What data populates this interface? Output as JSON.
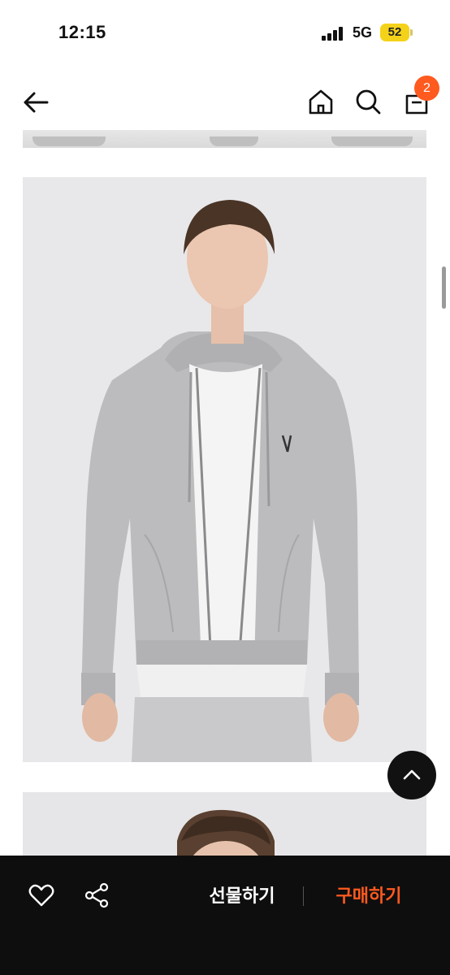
{
  "status_bar": {
    "time": "12:15",
    "network": "5G",
    "battery": "52"
  },
  "nav": {
    "back_icon": "arrow-left-icon",
    "home_icon": "home-icon",
    "search_icon": "search-icon",
    "bag_icon": "shopping-bag-icon",
    "cart_count": "2",
    "accent_color": "#ff5a1f"
  },
  "product": {
    "image_description_icon": "product-photo-grey-zip-hoodie"
  },
  "actions": {
    "wishlist_icon": "heart-icon",
    "share_icon": "share-icon",
    "gift_label": "선물하기",
    "buy_label": "구매하기",
    "scroll_top_icon": "chevron-up-icon"
  }
}
